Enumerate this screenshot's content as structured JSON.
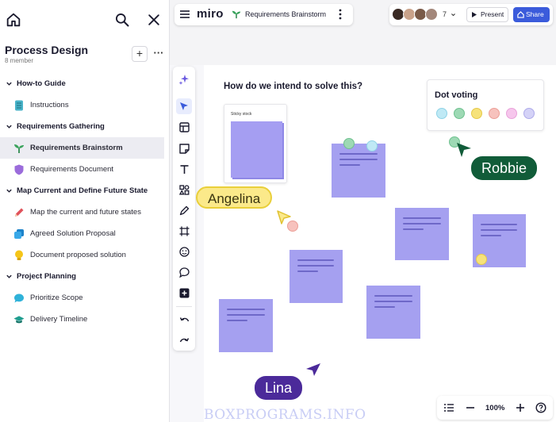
{
  "sidebar": {
    "board_title": "Process Design",
    "board_subtitle": "8 member",
    "add_label": "+",
    "more_label": "···",
    "sections": [
      {
        "label": "How-to Guide",
        "items": [
          {
            "label": "Instructions",
            "icon": "document-icon"
          }
        ]
      },
      {
        "label": "Requirements Gathering",
        "items": [
          {
            "label": "Requirements Brainstorm",
            "icon": "sprout-icon",
            "active": true
          },
          {
            "label": "Requirements Document",
            "icon": "shield-icon"
          }
        ]
      },
      {
        "label": "Map Current and Define Future State",
        "items": [
          {
            "label": "Map the current and future states",
            "icon": "pencil-icon"
          },
          {
            "label": "Agreed Solution Proposal",
            "icon": "stack-icon"
          },
          {
            "label": "Document proposed solution",
            "icon": "lightbulb-icon"
          }
        ]
      },
      {
        "label": "Project Planning",
        "items": [
          {
            "label": "Prioritize Scope",
            "icon": "speech-bubble-icon"
          },
          {
            "label": "Delivery Timeline",
            "icon": "graduation-cap-icon"
          }
        ]
      }
    ]
  },
  "topbar": {
    "logo": "miro",
    "board_name": "Requirements Brainstorm",
    "collaborator_count": "7",
    "present_label": "Present",
    "share_label": "Share"
  },
  "canvas": {
    "question": "How do we intend to solve this?",
    "sticky_card_label": "Sticky stock",
    "dot_voting_title": "Dot voting",
    "dot_colors": [
      "#bfe9f5",
      "#9dd9b4",
      "#f6e27a",
      "#f7c2bd",
      "#f6c6ec",
      "#d4d2f7"
    ],
    "cursors": [
      {
        "name": "Angelina",
        "color": "#fbe98a"
      },
      {
        "name": "Robbie",
        "color": "#115c39"
      },
      {
        "name": "Lina",
        "color": "#4b2a9a"
      }
    ]
  },
  "zoom": {
    "value": "100%"
  },
  "watermark": "BOXPROGRAMS.INFO",
  "colors": {
    "accent": "#3b5bdb",
    "sticky": "#a5a0f0"
  }
}
